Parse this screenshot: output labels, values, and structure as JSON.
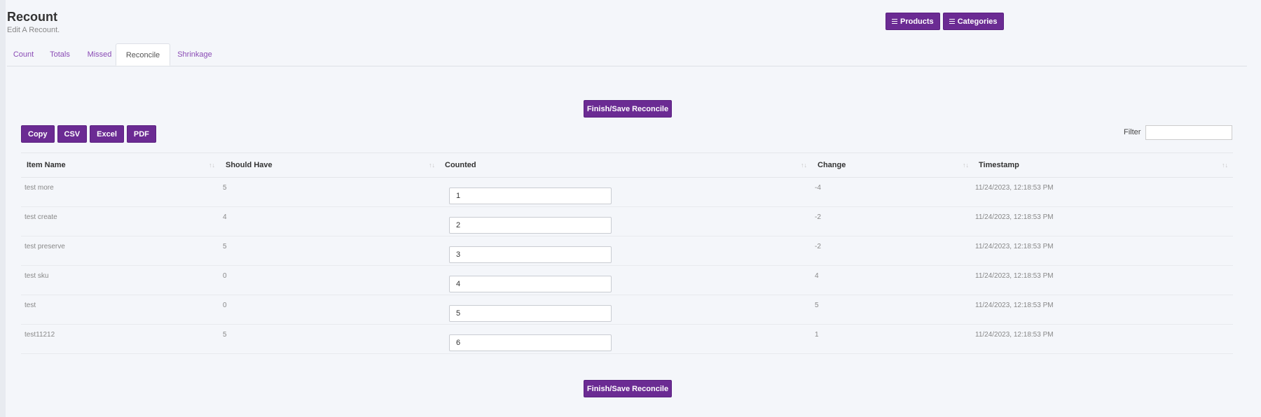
{
  "header": {
    "title": "Recount",
    "subtitle": "Edit A Recount."
  },
  "top_buttons": {
    "products": "Products",
    "categories": "Categories"
  },
  "tabs": [
    {
      "label": "Count"
    },
    {
      "label": "Totals"
    },
    {
      "label": "Missed"
    },
    {
      "label": "Reconcile",
      "active": true
    },
    {
      "label": "Shrinkage"
    }
  ],
  "finish_button": "Finish/Save Reconcile",
  "export_buttons": {
    "copy": "Copy",
    "csv": "CSV",
    "excel": "Excel",
    "pdf": "PDF"
  },
  "filter": {
    "label": "Filter",
    "value": ""
  },
  "table": {
    "headers": {
      "item_name": "Item Name",
      "should_have": "Should Have",
      "counted": "Counted",
      "change": "Change",
      "timestamp": "Timestamp"
    },
    "rows": [
      {
        "item_name": "test more",
        "should_have": "5",
        "counted": "1",
        "change": "-4",
        "timestamp": "11/24/2023, 12:18:53 PM"
      },
      {
        "item_name": "test create",
        "should_have": "4",
        "counted": "2",
        "change": "-2",
        "timestamp": "11/24/2023, 12:18:53 PM"
      },
      {
        "item_name": "test preserve",
        "should_have": "5",
        "counted": "3",
        "change": "-2",
        "timestamp": "11/24/2023, 12:18:53 PM"
      },
      {
        "item_name": "test sku",
        "should_have": "0",
        "counted": "4",
        "change": "4",
        "timestamp": "11/24/2023, 12:18:53 PM"
      },
      {
        "item_name": "test",
        "should_have": "0",
        "counted": "5",
        "change": "5",
        "timestamp": "11/24/2023, 12:18:53 PM"
      },
      {
        "item_name": "test11212",
        "should_have": "5",
        "counted": "6",
        "change": "1",
        "timestamp": "11/24/2023, 12:18:53 PM"
      }
    ]
  },
  "colors": {
    "accent": "#6b2b93",
    "tab_link": "#8a4bb5",
    "background": "#f4f6fa"
  }
}
